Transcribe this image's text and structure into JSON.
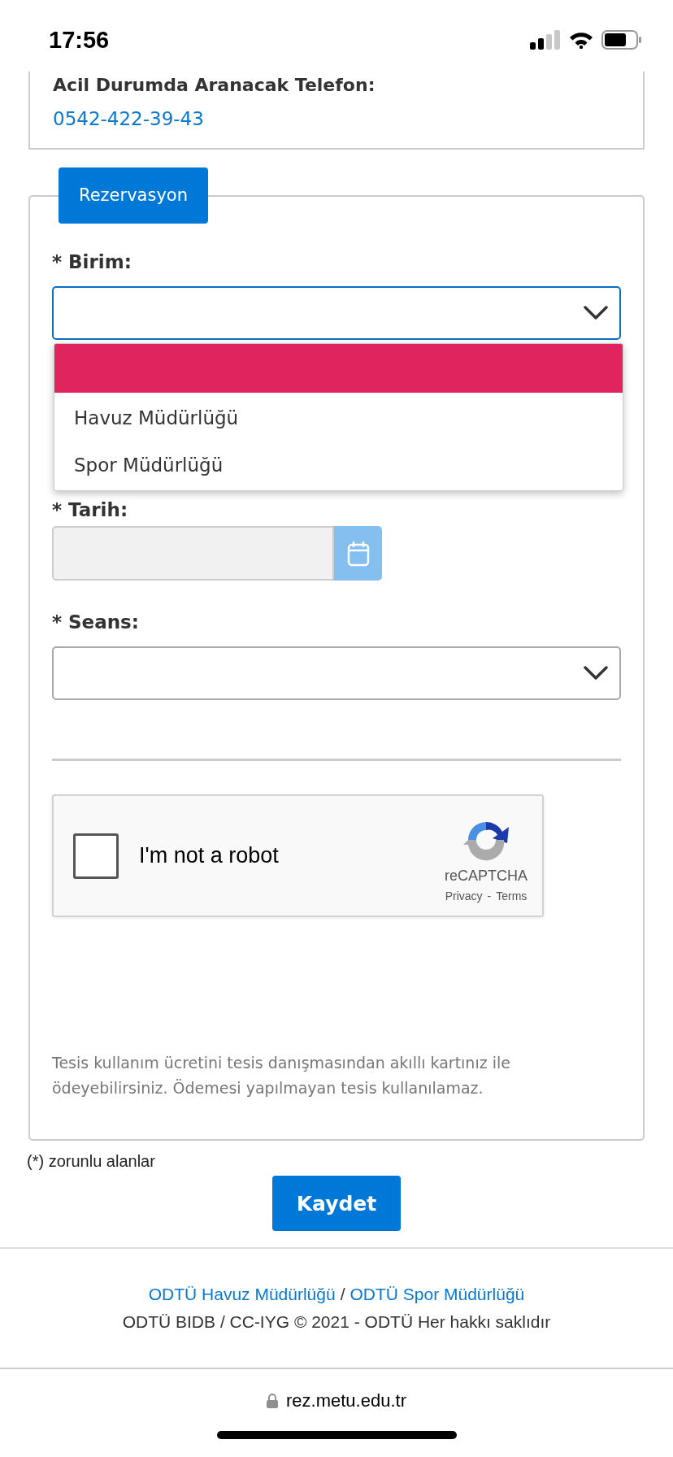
{
  "status_bar": {
    "time": "17:56"
  },
  "emergency": {
    "label": "Acil Durumda Aranacak Telefon:",
    "phone": "0542-422-39-43"
  },
  "form": {
    "legend": "Rezervasyon",
    "fields": [
      {
        "kind": "select",
        "label": "* Birim:",
        "focused": true
      },
      {
        "kind": "date",
        "label": "* Tarih:"
      },
      {
        "kind": "select",
        "label": "* Seans:",
        "focused": false
      }
    ],
    "dropdown": {
      "blank_option_highlighted": true,
      "options": [
        {
          "label": "Havuz Müdürlüğü",
          "selected": false
        },
        {
          "label": "Spor Müdürlüğü",
          "selected": false
        }
      ]
    },
    "captcha": {
      "label": "I'm not a robot",
      "checked": false,
      "brand": "reCAPTCHA",
      "privacy": "Privacy",
      "separator": "-",
      "terms": "Terms"
    },
    "note": "Tesis kullanım ücretini tesis danışmasından akıllı kartınız ile ödeyebilirsiniz. Ödemesi yapılmayan tesis kullanılamaz."
  },
  "required_note": "(*) zorunlu alanlar",
  "save_button": "Kaydet",
  "footer": {
    "links": [
      "ODTÜ Havuz Müdürlüğü",
      "ODTÜ Spor Müdürlüğü"
    ],
    "separator": "/",
    "copyright": "ODTÜ BIDB / CC-IYG © 2021 - ODTÜ Her hakkı saklıdır"
  },
  "browser": {
    "url": "rez.metu.edu.tr"
  }
}
